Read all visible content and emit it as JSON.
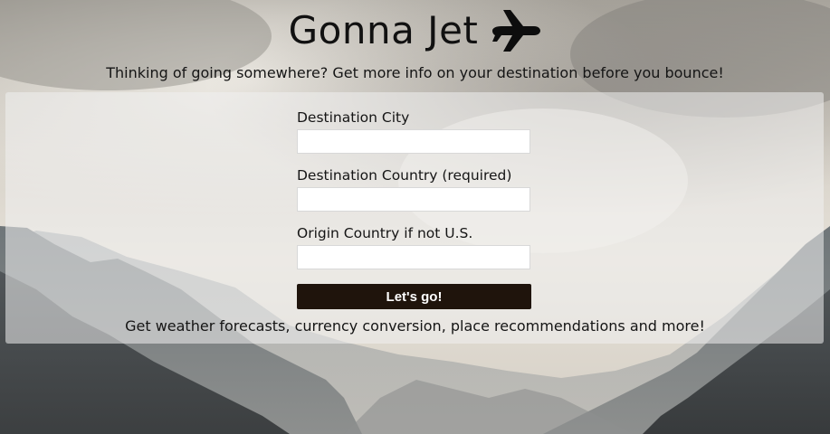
{
  "header": {
    "title": "Gonna Jet",
    "tagline": "Thinking of going somewhere? Get more info on your destination before you bounce!"
  },
  "form": {
    "destination_city": {
      "label": "Destination City",
      "value": "",
      "placeholder": ""
    },
    "destination_country": {
      "label": "Destination Country (required)",
      "value": "",
      "placeholder": ""
    },
    "origin_country": {
      "label": "Origin Country if not U.S.",
      "value": "",
      "placeholder": ""
    },
    "submit_label": "Let's go!"
  },
  "footer": {
    "text": "Get weather forecasts, currency conversion, place recommendations and more!"
  },
  "icons": {
    "title_icon": "airplane-icon"
  },
  "colors": {
    "button_bg": "#1f140c",
    "button_text": "#ffffff",
    "panel_bg": "rgba(240,240,240,0.55)"
  }
}
